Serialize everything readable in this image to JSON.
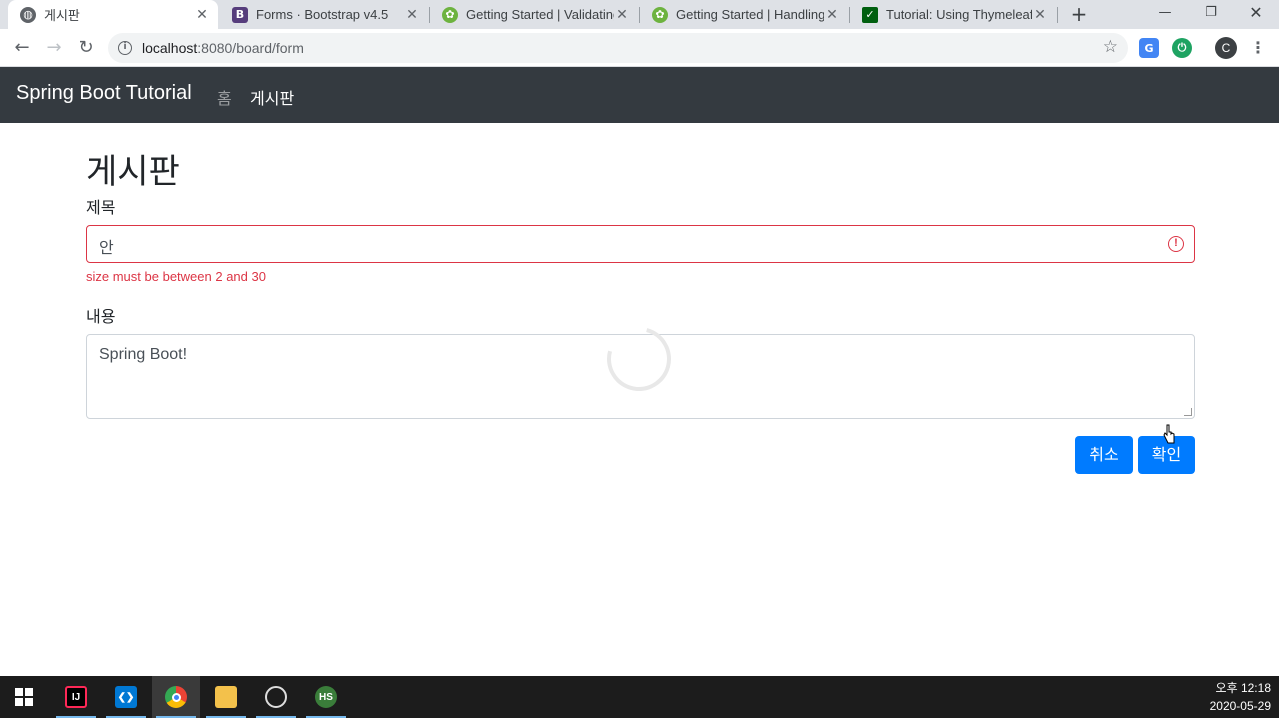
{
  "browser": {
    "tabs": [
      {
        "title": "게시판",
        "icon": "globe-icon",
        "active": true
      },
      {
        "title": "Forms · Bootstrap v4.5",
        "icon": "bootstrap-icon"
      },
      {
        "title": "Getting Started | Validating",
        "icon": "spring-icon"
      },
      {
        "title": "Getting Started | Handling",
        "icon": "spring-icon"
      },
      {
        "title": "Tutorial: Using Thymeleaf",
        "icon": "thymeleaf-icon"
      }
    ],
    "url_host": "localhost",
    "url_path": ":8080/board/form",
    "profile_initial": "C"
  },
  "navbar": {
    "brand": "Spring Boot Tutorial",
    "links": [
      {
        "label": "홈",
        "active": false
      },
      {
        "label": "게시판",
        "active": true
      }
    ]
  },
  "form": {
    "heading": "게시판",
    "title_label": "제목",
    "title_value": "안",
    "title_error": "size must be between 2 and 30",
    "content_label": "내용",
    "content_value": "Spring Boot!",
    "cancel_label": "취소",
    "submit_label": "확인"
  },
  "taskbar": {
    "apps": [
      "start-icon",
      "intellij-icon",
      "vscode-icon",
      "chrome-icon",
      "file-explorer-icon",
      "obs-icon",
      "hs-icon"
    ],
    "time": "오후 12:18",
    "date": "2020-05-29"
  },
  "colors": {
    "navbar": "#343a40",
    "primary": "#007bff",
    "danger": "#dc3545"
  }
}
